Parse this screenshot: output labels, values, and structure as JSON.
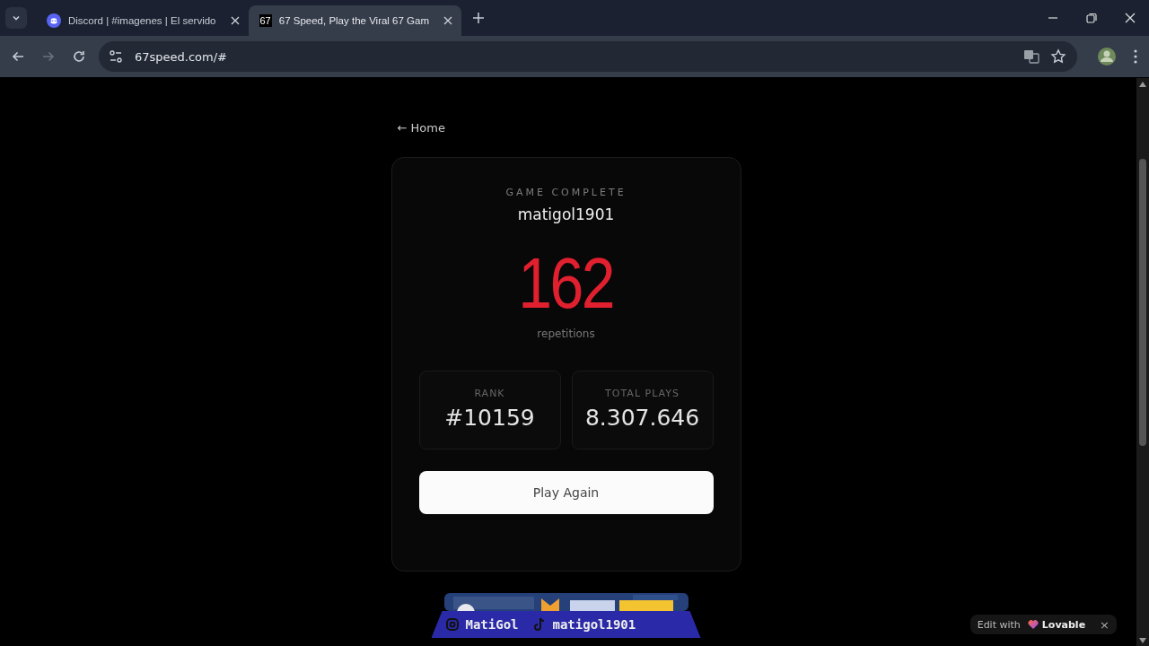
{
  "browser": {
    "tabs": [
      {
        "title": "Discord | #imagenes | El servido",
        "selected": false
      },
      {
        "title": "67 Speed, Play the Viral 67 Gam",
        "favicon": "67",
        "selected": true
      }
    ],
    "address": "67speed.com/#"
  },
  "page": {
    "back_link": "← Home",
    "card": {
      "heading": "GAME COMPLETE",
      "player": "matigol1901",
      "score": "162",
      "score_label": "repetitions",
      "stats": [
        {
          "label": "RANK",
          "value": "#10159"
        },
        {
          "label": "TOTAL PLAYS",
          "value": "8.307.646"
        }
      ],
      "button": "Play Again"
    }
  },
  "overlay": {
    "names": [
      {
        "text": "MatiGol"
      },
      {
        "text": "matigol1901"
      }
    ]
  },
  "badge": {
    "prefix": "Edit with",
    "brand": "Lovable",
    "close": "×"
  }
}
